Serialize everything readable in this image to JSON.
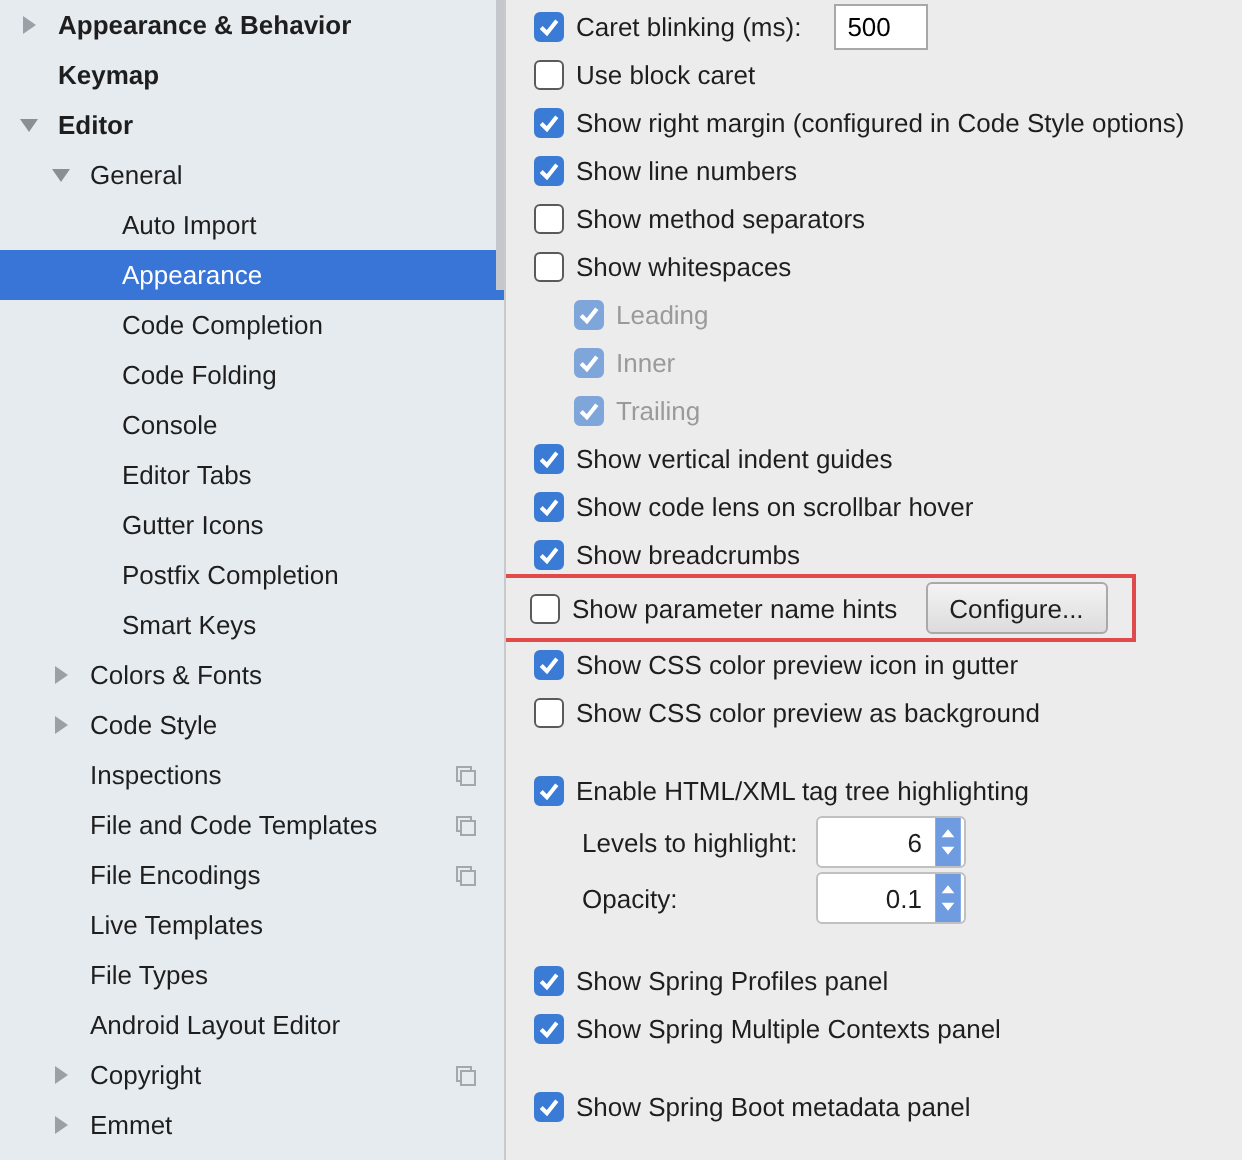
{
  "sidebar": {
    "tree": [
      {
        "label": "Appearance & Behavior",
        "expanded": false,
        "selected": false,
        "project_icon": false
      },
      {
        "label": "Keymap",
        "selected": false,
        "project_icon": false
      },
      {
        "label": "Editor",
        "expanded": true,
        "selected": false,
        "project_icon": false,
        "children": [
          {
            "label": "General",
            "expanded": true,
            "selected": false,
            "project_icon": false,
            "children": [
              {
                "label": "Auto Import",
                "selected": false,
                "project_icon": false
              },
              {
                "label": "Appearance",
                "selected": true,
                "project_icon": false
              },
              {
                "label": "Code Completion",
                "selected": false,
                "project_icon": false
              },
              {
                "label": "Code Folding",
                "selected": false,
                "project_icon": false
              },
              {
                "label": "Console",
                "selected": false,
                "project_icon": false
              },
              {
                "label": "Editor Tabs",
                "selected": false,
                "project_icon": false
              },
              {
                "label": "Gutter Icons",
                "selected": false,
                "project_icon": false
              },
              {
                "label": "Postfix Completion",
                "selected": false,
                "project_icon": false
              },
              {
                "label": "Smart Keys",
                "selected": false,
                "project_icon": false
              }
            ]
          },
          {
            "label": "Colors & Fonts",
            "expanded": false,
            "selected": false,
            "project_icon": false
          },
          {
            "label": "Code Style",
            "expanded": false,
            "selected": false,
            "project_icon": false
          },
          {
            "label": "Inspections",
            "selected": false,
            "project_icon": true
          },
          {
            "label": "File and Code Templates",
            "selected": false,
            "project_icon": true
          },
          {
            "label": "File Encodings",
            "selected": false,
            "project_icon": true
          },
          {
            "label": "Live Templates",
            "selected": false,
            "project_icon": false
          },
          {
            "label": "File Types",
            "selected": false,
            "project_icon": false
          },
          {
            "label": "Android Layout Editor",
            "selected": false,
            "project_icon": false
          },
          {
            "label": "Copyright",
            "expanded": false,
            "selected": false,
            "project_icon": true
          },
          {
            "label": "Emmet",
            "expanded": false,
            "selected": false,
            "project_icon": false
          }
        ]
      }
    ]
  },
  "settings": {
    "groups": [
      {
        "items": [
          {
            "kind": "checkbox",
            "label": "Caret blinking (ms):",
            "checked": true,
            "disabled": false,
            "value": "500"
          },
          {
            "kind": "checkbox",
            "label": "Use block caret",
            "checked": false,
            "disabled": false
          },
          {
            "kind": "checkbox",
            "label": "Show right margin (configured in Code Style options)",
            "checked": true,
            "disabled": false
          },
          {
            "kind": "checkbox",
            "label": "Show line numbers",
            "checked": true,
            "disabled": false
          },
          {
            "kind": "checkbox",
            "label": "Show method separators",
            "checked": false,
            "disabled": false
          },
          {
            "kind": "checkbox",
            "label": "Show whitespaces",
            "checked": false,
            "disabled": false,
            "children": [
              {
                "kind": "checkbox",
                "label": "Leading",
                "checked": true,
                "disabled": true
              },
              {
                "kind": "checkbox",
                "label": "Inner",
                "checked": true,
                "disabled": true
              },
              {
                "kind": "checkbox",
                "label": "Trailing",
                "checked": true,
                "disabled": true
              }
            ]
          },
          {
            "kind": "checkbox",
            "label": "Show vertical indent guides",
            "checked": true,
            "disabled": false
          },
          {
            "kind": "checkbox",
            "label": "Show code lens on scrollbar hover",
            "checked": true,
            "disabled": false
          },
          {
            "kind": "checkbox",
            "label": "Show breadcrumbs",
            "checked": true,
            "disabled": false
          },
          {
            "kind": "checkbox",
            "label": "Show parameter name hints",
            "checked": false,
            "disabled": false,
            "button": "Configure...",
            "highlighted": true
          },
          {
            "kind": "checkbox",
            "label": "Show CSS color preview icon in gutter",
            "checked": true,
            "disabled": false
          },
          {
            "kind": "checkbox",
            "label": "Show CSS color preview as background",
            "checked": false,
            "disabled": false
          }
        ]
      },
      {
        "items": [
          {
            "kind": "checkbox",
            "label": "Enable HTML/XML tag tree highlighting",
            "checked": true,
            "disabled": false,
            "children": [
              {
                "kind": "spinner",
                "label": "Levels to highlight:",
                "value": "6"
              },
              {
                "kind": "spinner",
                "label": "Opacity:",
                "value": "0.1"
              }
            ]
          }
        ]
      },
      {
        "items": [
          {
            "kind": "checkbox",
            "label": "Show Spring Profiles panel",
            "checked": true,
            "disabled": false
          },
          {
            "kind": "checkbox",
            "label": "Show Spring Multiple Contexts panel",
            "checked": true,
            "disabled": false
          }
        ]
      },
      {
        "items": [
          {
            "kind": "checkbox",
            "label": "Show Spring Boot metadata panel",
            "checked": true,
            "disabled": false
          }
        ]
      }
    ]
  }
}
